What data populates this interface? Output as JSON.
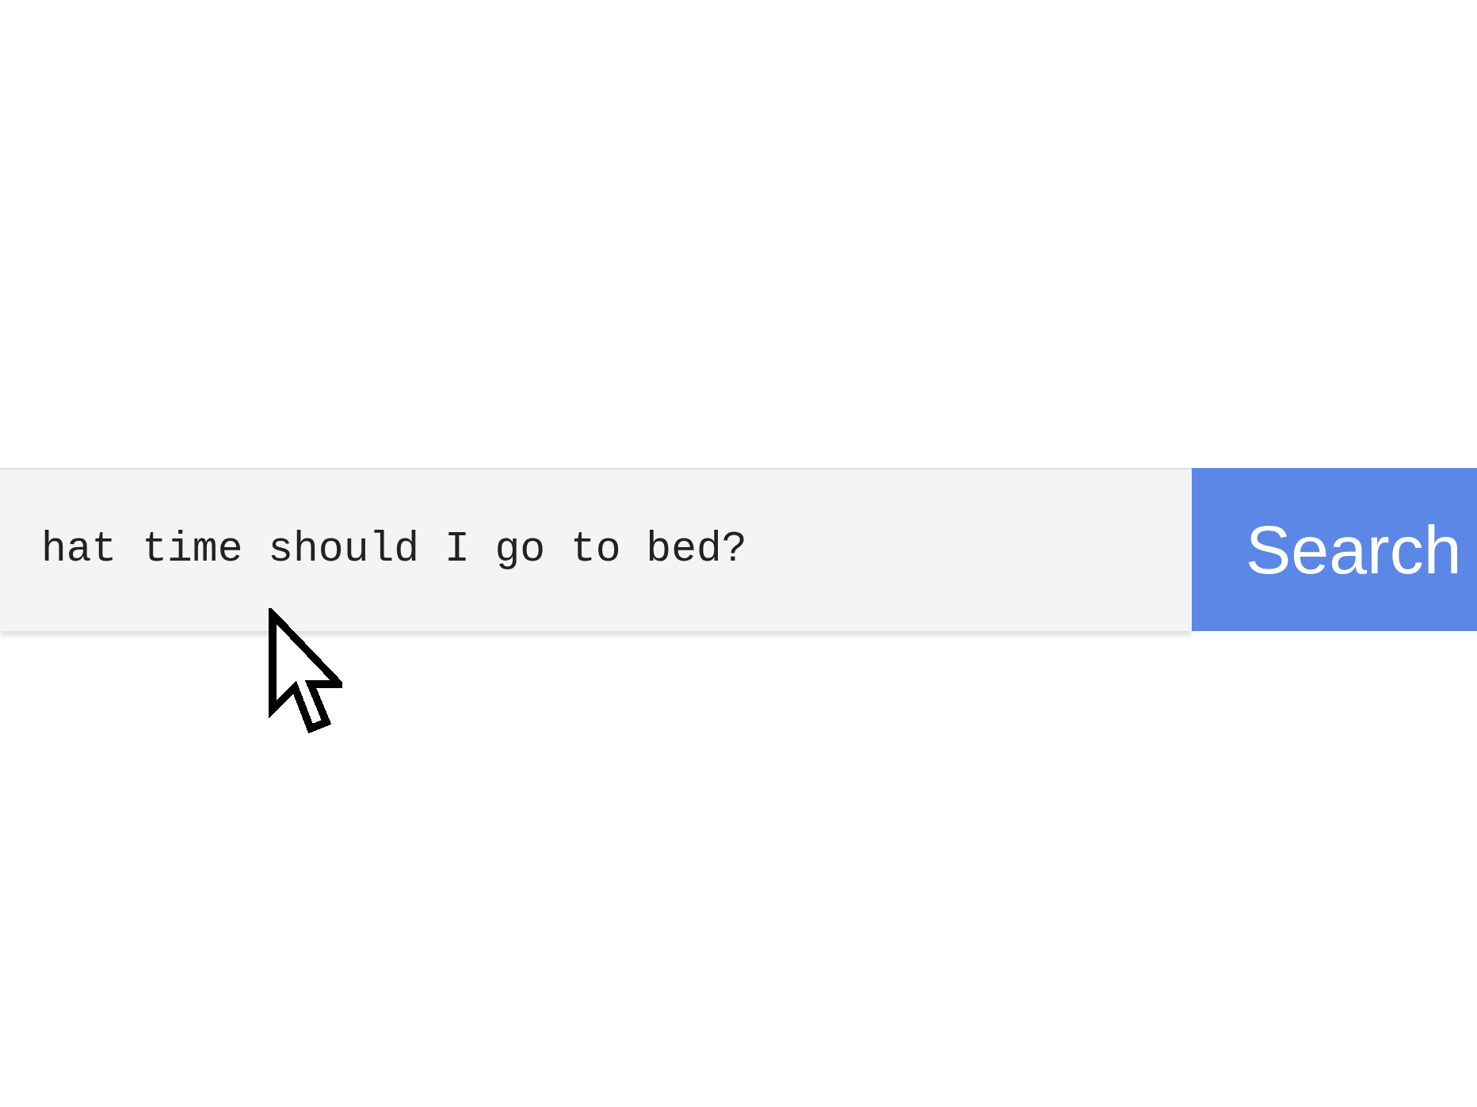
{
  "search": {
    "value": "hat time should I go to bed?",
    "button": "Search"
  }
}
